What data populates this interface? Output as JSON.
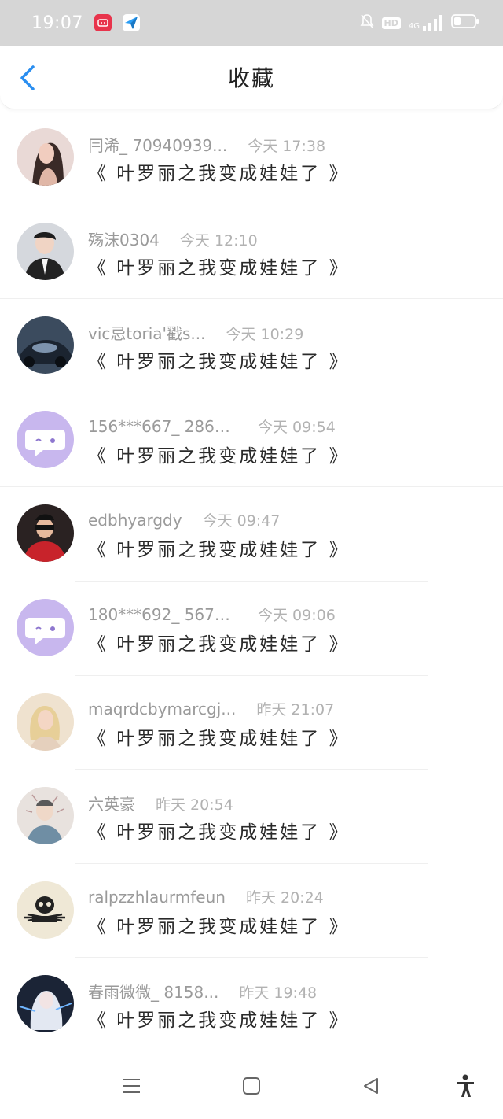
{
  "status_bar": {
    "time": "19:07",
    "indicators": [
      "bell-off-icon",
      "hd-icon",
      "signal-4g-icon",
      "battery-icon"
    ],
    "app_icons": [
      "red-app-icon",
      "blue-app-icon"
    ],
    "hd_label": "HD",
    "network_label": "4G"
  },
  "nav": {
    "title": "收藏",
    "back_icon": "chevron-left-icon",
    "accent_color": "#2a8ef0"
  },
  "items": [
    {
      "user": "冃浠_ 70940939...",
      "time": "今天 17:38",
      "content": "《 叶罗丽之我变成娃娃了 》",
      "avatar": "photo-woman"
    },
    {
      "user": "殇沫0304",
      "time": "今天 12:10",
      "content": "《 叶罗丽之我变成娃娃了 》",
      "avatar": "photo-man-suit"
    },
    {
      "user": "vic忌toria'戳s...",
      "time": "今天 10:29",
      "content": "《 叶罗丽之我变成娃娃了 》",
      "avatar": "photo-car"
    },
    {
      "user": "156***667_ 2869...",
      "time": "今天 09:54",
      "content": "《 叶罗丽之我变成娃娃了 》",
      "avatar": "default-chat-avatar"
    },
    {
      "user": "edbhyargdy",
      "time": "今天 09:47",
      "content": "《 叶罗丽之我变成娃娃了 》",
      "avatar": "photo-man-red"
    },
    {
      "user": "180***692_ 5671...",
      "time": "今天 09:06",
      "content": "《 叶罗丽之我变成娃娃了 》",
      "avatar": "default-chat-avatar"
    },
    {
      "user": "maqrdcbymarcgj...",
      "time": "昨天 21:07",
      "content": "《 叶罗丽之我变成娃娃了 》",
      "avatar": "photo-blonde"
    },
    {
      "user": "六英豪",
      "time": "昨天 20:54",
      "content": "《 叶罗丽之我变成娃娃了 》",
      "avatar": "photo-drawing"
    },
    {
      "user": "ralpzzhlaurmfeun",
      "time": "昨天 20:24",
      "content": "《 叶罗丽之我变成娃娃了 》",
      "avatar": "photo-skull"
    },
    {
      "user": "春雨微微_ 8158...",
      "time": "昨天 19:48",
      "content": "《 叶罗丽之我变成娃娃了 》",
      "avatar": "photo-anime"
    }
  ],
  "bottom_nav": {
    "buttons": [
      "menu-icon",
      "home-icon",
      "back-icon",
      "accessibility-icon"
    ]
  }
}
